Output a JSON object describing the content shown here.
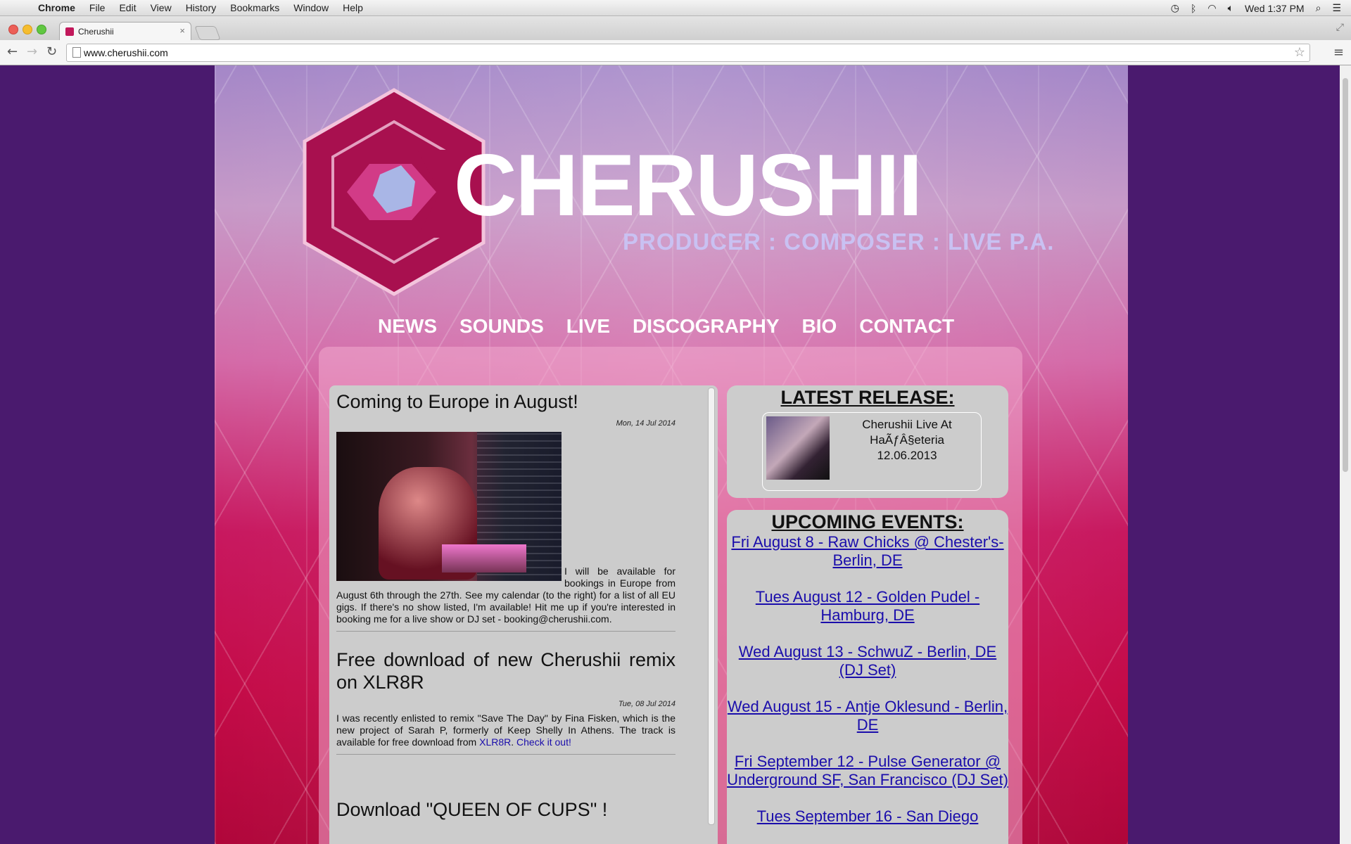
{
  "menubar": {
    "items": [
      "Chrome",
      "File",
      "Edit",
      "View",
      "History",
      "Bookmarks",
      "Window",
      "Help"
    ],
    "clock": "Wed 1:37 PM"
  },
  "browser": {
    "tab_title": "Cherushii",
    "url": "www.cherushii.com"
  },
  "site": {
    "brand": "CHERUSHII",
    "tagline": "PRODUCER : COMPOSER : LIVE P.A.",
    "nav": [
      "NEWS",
      "SOUNDS",
      "LIVE",
      "DISCOGRAPHY",
      "BIO",
      "CONTACT"
    ]
  },
  "news": {
    "posts": [
      {
        "title": "Coming to Europe in August!",
        "date": "Mon, 14 Jul 2014",
        "body": "I will be available for bookings in Europe from August 6th through the 27th. See my calendar (to the right) for a list of all EU gigs. If there's no show listed, I'm available! Hit me up if you're interested in booking me for a live show or DJ set - booking@cherushii.com."
      },
      {
        "title": "Free download of new Cherushii remix on XLR8R",
        "date": "Tue, 08 Jul 2014",
        "body": "I was recently enlisted to remix \"Save The Day\" by Fina Fisken, which is the new project of Sarah P, formerly of Keep Shelly In Athens. The track is available for free download from ",
        "link1": "XLR8R",
        "sep": ". ",
        "link2": "Check it out!"
      },
      {
        "title": "Download \"QUEEN OF CUPS\" !"
      }
    ]
  },
  "release": {
    "heading": "LATEST RELEASE:",
    "title": "Cherushii Live At HaÃƒÂ§eteria 12.06.2013"
  },
  "events": {
    "heading": "UPCOMING EVENTS:",
    "items": [
      "Fri August 8 - Raw Chicks @ Chester's- Berlin, DE",
      "Tues August 12 - Golden Pudel - Hamburg, DE",
      "Wed August 13 - SchwuZ - Berlin, DE (DJ Set)",
      "Wed August 15 - Antje Oklesund - Berlin, DE",
      "Fri September 12 - Pulse Generator @ Underground SF, San Francisco (DJ Set)",
      "Tues September 16 - San Diego"
    ]
  }
}
